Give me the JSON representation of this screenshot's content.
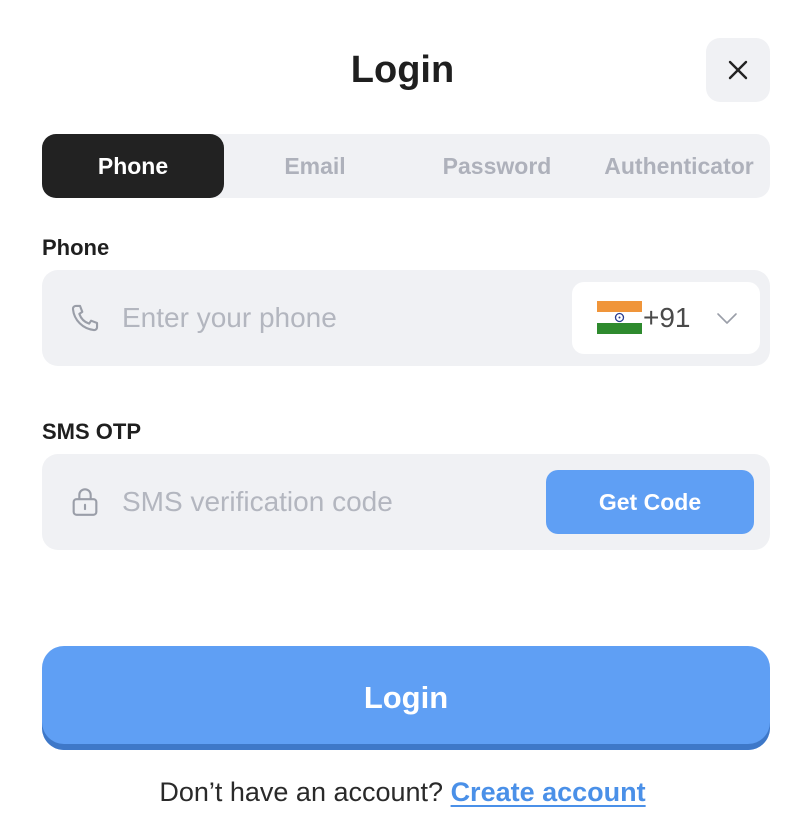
{
  "header": {
    "title": "Login",
    "close_icon": "close-icon"
  },
  "tabs": [
    {
      "label": "Phone",
      "active": true
    },
    {
      "label": "Email",
      "active": false
    },
    {
      "label": "Password",
      "active": false
    },
    {
      "label": "Authenticator",
      "active": false
    }
  ],
  "phone_field": {
    "label": "Phone",
    "icon": "phone-icon",
    "placeholder": "Enter your phone",
    "value": "",
    "country": {
      "flag_icon": "india-flag-icon",
      "dial_code": "+91",
      "chevron_icon": "chevron-down-icon"
    }
  },
  "otp_field": {
    "label": "SMS OTP",
    "icon": "lock-icon",
    "placeholder": "SMS verification code",
    "value": "",
    "get_code_label": "Get Code"
  },
  "login_button": {
    "label": "Login"
  },
  "signup": {
    "text": "Don’t have an account?",
    "link": "Create account"
  },
  "colors": {
    "accent": "#5f9ff4",
    "active_tab": "#222222",
    "field_bg": "#f0f1f4",
    "link": "#4a90e8"
  }
}
